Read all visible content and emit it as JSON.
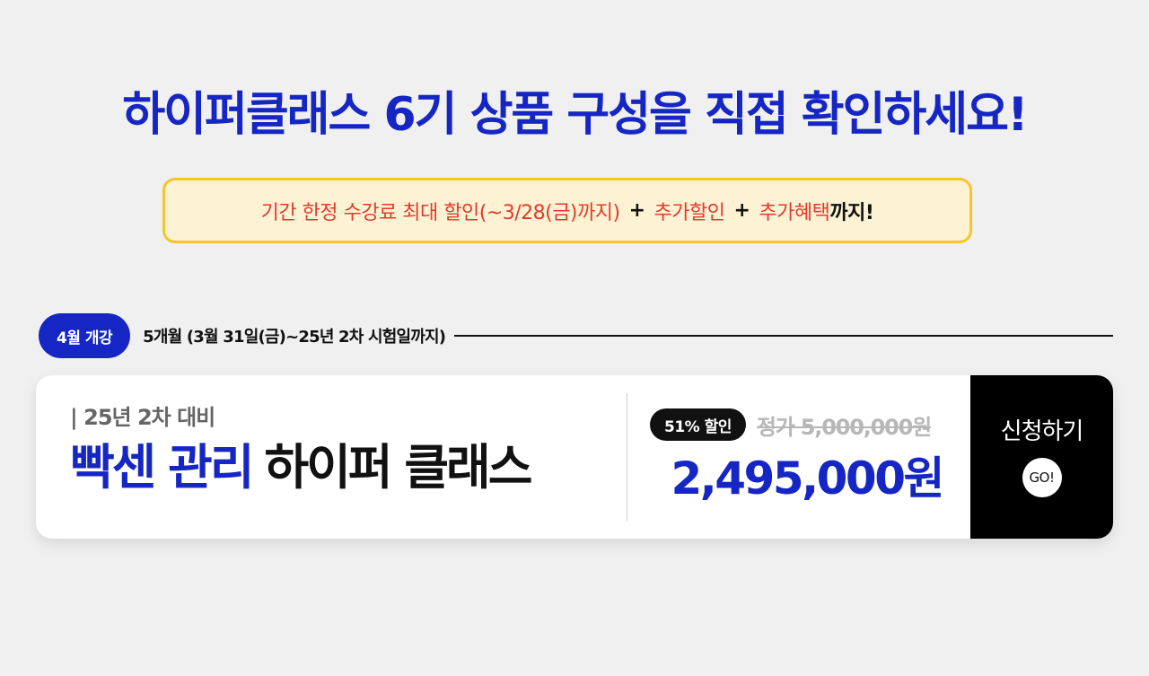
{
  "headline": "하이퍼클래스 6기 상품 구성을 직접 확인하세요!",
  "promo": {
    "part1": "기간 한정 수강료 최대 할인(~3/28(금)까지)",
    "plus1": "+",
    "part2": "추가할인",
    "plus2": "+",
    "part3": "추가혜택",
    "part3_suffix": "까지!"
  },
  "schedule": {
    "badge": "4월 개강",
    "period": "5개월 (3월 31일(금)~25년 2차 시험일까지)"
  },
  "product": {
    "compare_label": "| 25년 2차 대비",
    "name_accent": "빡센 관리",
    "name_plain": "하이퍼 클래스",
    "discount_badge": "51% 할인",
    "original_price": "정가 5,000,000원",
    "final_price": "2,495,000원"
  },
  "cta": {
    "label": "신청하기",
    "go": "GO!"
  },
  "colors": {
    "brand_blue": "#1526c4",
    "promo_red": "#e43a2c",
    "promo_border": "#f6c52c",
    "promo_bg": "#fdf3d4"
  }
}
